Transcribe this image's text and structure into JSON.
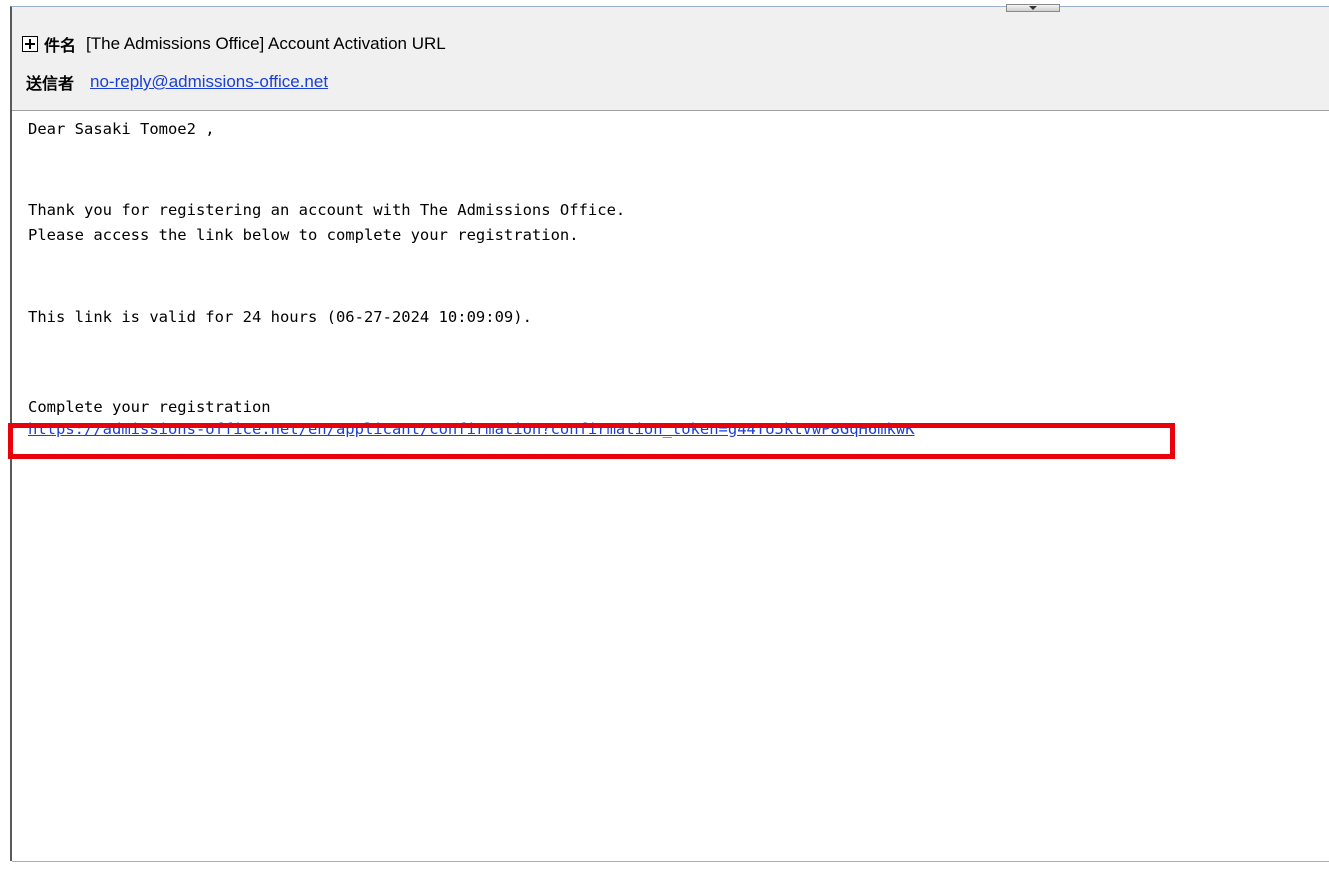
{
  "email": {
    "subject_label": "件名",
    "subject": "[The Admissions Office] Account Activation URL",
    "sender_label": "送信者",
    "sender": "no-reply@admissions-office.net"
  },
  "body": {
    "greeting": "Dear Sasaki Tomoe2 ,",
    "line1": "Thank you for registering an account with The Admissions Office.",
    "line2": "Please access the link below to complete your registration.",
    "validity": "This link is valid for 24 hours (06-27-2024 10:09:09).",
    "cta_label": "Complete your registration",
    "confirmation_link": "https://admissions-office.net/en/applicant/confirmation?confirmation_token=g44To5ktVwP8GqH6mkwK"
  },
  "colors": {
    "link": "#1a3fd6",
    "highlight": "#e8000b",
    "header_bg": "#f0f0f0"
  },
  "icons": {
    "expand": "plus-box-icon",
    "collapse": "chevron-down-icon"
  }
}
